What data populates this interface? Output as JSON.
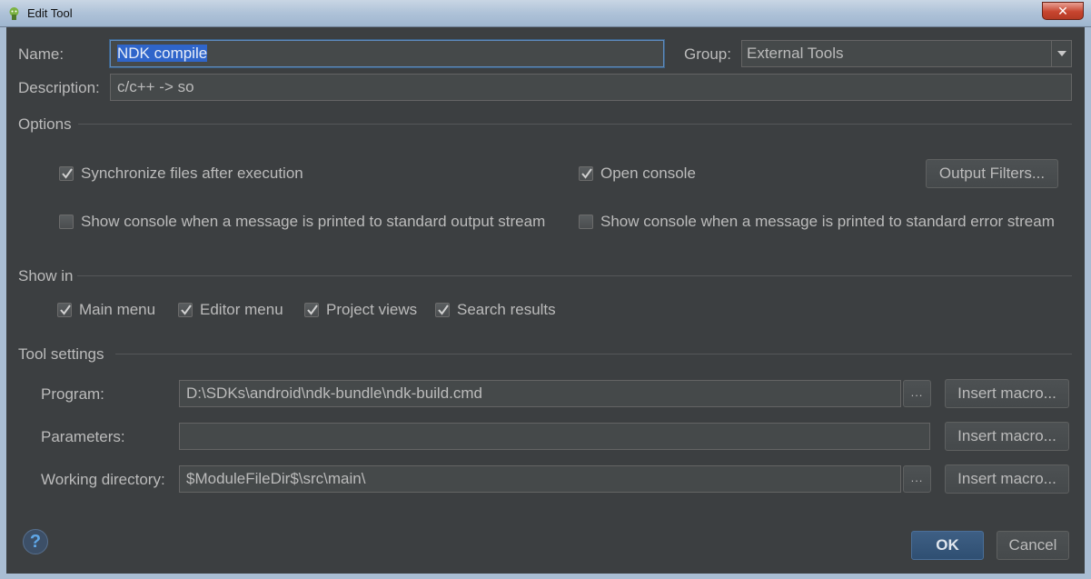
{
  "window": {
    "title": "Edit Tool",
    "close_label": "✕"
  },
  "name": {
    "label": "Name:",
    "value": "NDK compile"
  },
  "group": {
    "label": "Group:",
    "value": "External Tools"
  },
  "description": {
    "label": "Description:",
    "value": "c/c++ -> so"
  },
  "options": {
    "title": "Options",
    "sync_files": {
      "label": "Synchronize files after execution",
      "checked": true
    },
    "open_console": {
      "label": "Open console",
      "checked": true
    },
    "output_filters": "Output Filters...",
    "show_console_stdout": {
      "label": "Show console when a message is printed to standard output stream",
      "checked": false
    },
    "show_console_stderr": {
      "label": "Show console when a message is printed to standard error stream",
      "checked": false
    }
  },
  "show_in": {
    "title": "Show in",
    "items": [
      {
        "label": "Main menu",
        "checked": true
      },
      {
        "label": "Editor menu",
        "checked": true
      },
      {
        "label": "Project views",
        "checked": true
      },
      {
        "label": "Search results",
        "checked": true
      }
    ]
  },
  "tool_settings": {
    "title": "Tool settings",
    "program": {
      "label": "Program:",
      "value": "D:\\SDKs\\android\\ndk-bundle\\ndk-build.cmd"
    },
    "parameters": {
      "label": "Parameters:",
      "value": ""
    },
    "working_directory": {
      "label": "Working directory:",
      "value": "$ModuleFileDir$\\src\\main\\"
    },
    "browse_label": "...",
    "insert_macro_label": "Insert macro..."
  },
  "footer": {
    "help_label": "?",
    "ok_label": "OK",
    "cancel_label": "Cancel"
  },
  "colors": {
    "background": "#3c3f41",
    "selection": "#2f65ca",
    "primary_button": "#365880"
  }
}
